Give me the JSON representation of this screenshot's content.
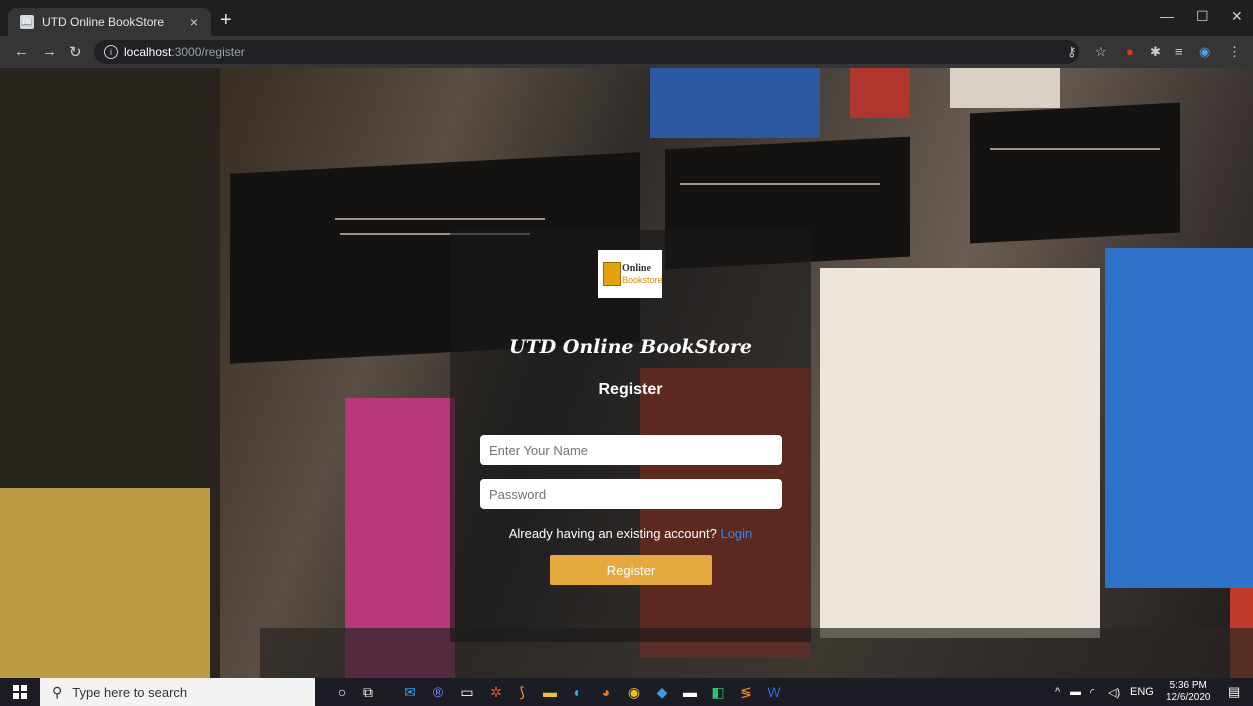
{
  "browser": {
    "tab_title": "UTD Online BookStore",
    "tab_close": "×",
    "new_tab": "+",
    "url_host": "localhost",
    "url_path": ":3000/register",
    "window_minimize": "—",
    "window_maximize": "☐",
    "window_close": "✕"
  },
  "card": {
    "logo_line1": "Online",
    "logo_line2": "Bookstore",
    "brand": "UTD Online BookStore",
    "heading": "Register",
    "name_placeholder": "Enter Your Name",
    "password_placeholder": "Password",
    "prompt_text": "Already having an existing account?",
    "login_link": "Login",
    "submit_label": "Register"
  },
  "taskbar": {
    "search_placeholder": "Type here to search",
    "language": "ENG",
    "time": "5:36 PM",
    "date": "12/6/2020"
  },
  "colors": {
    "accent_button": "#e6a93f",
    "link": "#2f86ff",
    "card_overlay": "rgba(25,25,25,0.62)"
  }
}
